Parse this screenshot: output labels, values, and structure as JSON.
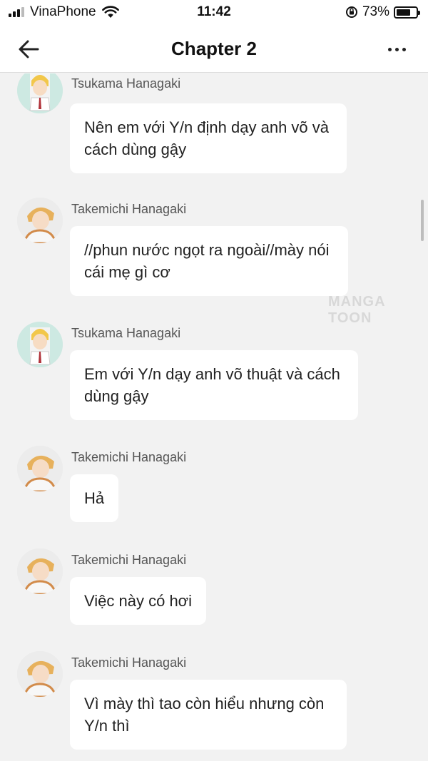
{
  "status_bar": {
    "carrier": "VinaPhone",
    "time": "11:42",
    "battery": "73%",
    "battery_level": 0.73
  },
  "nav": {
    "title": "Chapter 2"
  },
  "watermark": "MANGA TOON",
  "messages": [
    {
      "sender": "Tsukama Hanagaki",
      "avatar": "tsukama-avatar",
      "text": "Nên em với Y/n định dạy anh võ và cách dùng gậy"
    },
    {
      "sender": "Takemichi Hanagaki",
      "avatar": "takemichi-avatar",
      "text": "//phun nước ngọt ra ngoài//mày nói cái mẹ gì cơ"
    },
    {
      "sender": "Tsukama Hanagaki",
      "avatar": "tsukama-avatar",
      "text": "Em với Y/n dạy anh võ thuật và cách dùng gậy"
    },
    {
      "sender": "Takemichi Hanagaki",
      "avatar": "takemichi-avatar",
      "text": "Hả"
    },
    {
      "sender": "Takemichi Hanagaki",
      "avatar": "takemichi-avatar",
      "text": "Việc này có hơi"
    },
    {
      "sender": "Takemichi Hanagaki",
      "avatar": "takemichi-avatar",
      "text": "Vì mày thì tao còn hiểu nhưng còn Y/n thì"
    }
  ]
}
